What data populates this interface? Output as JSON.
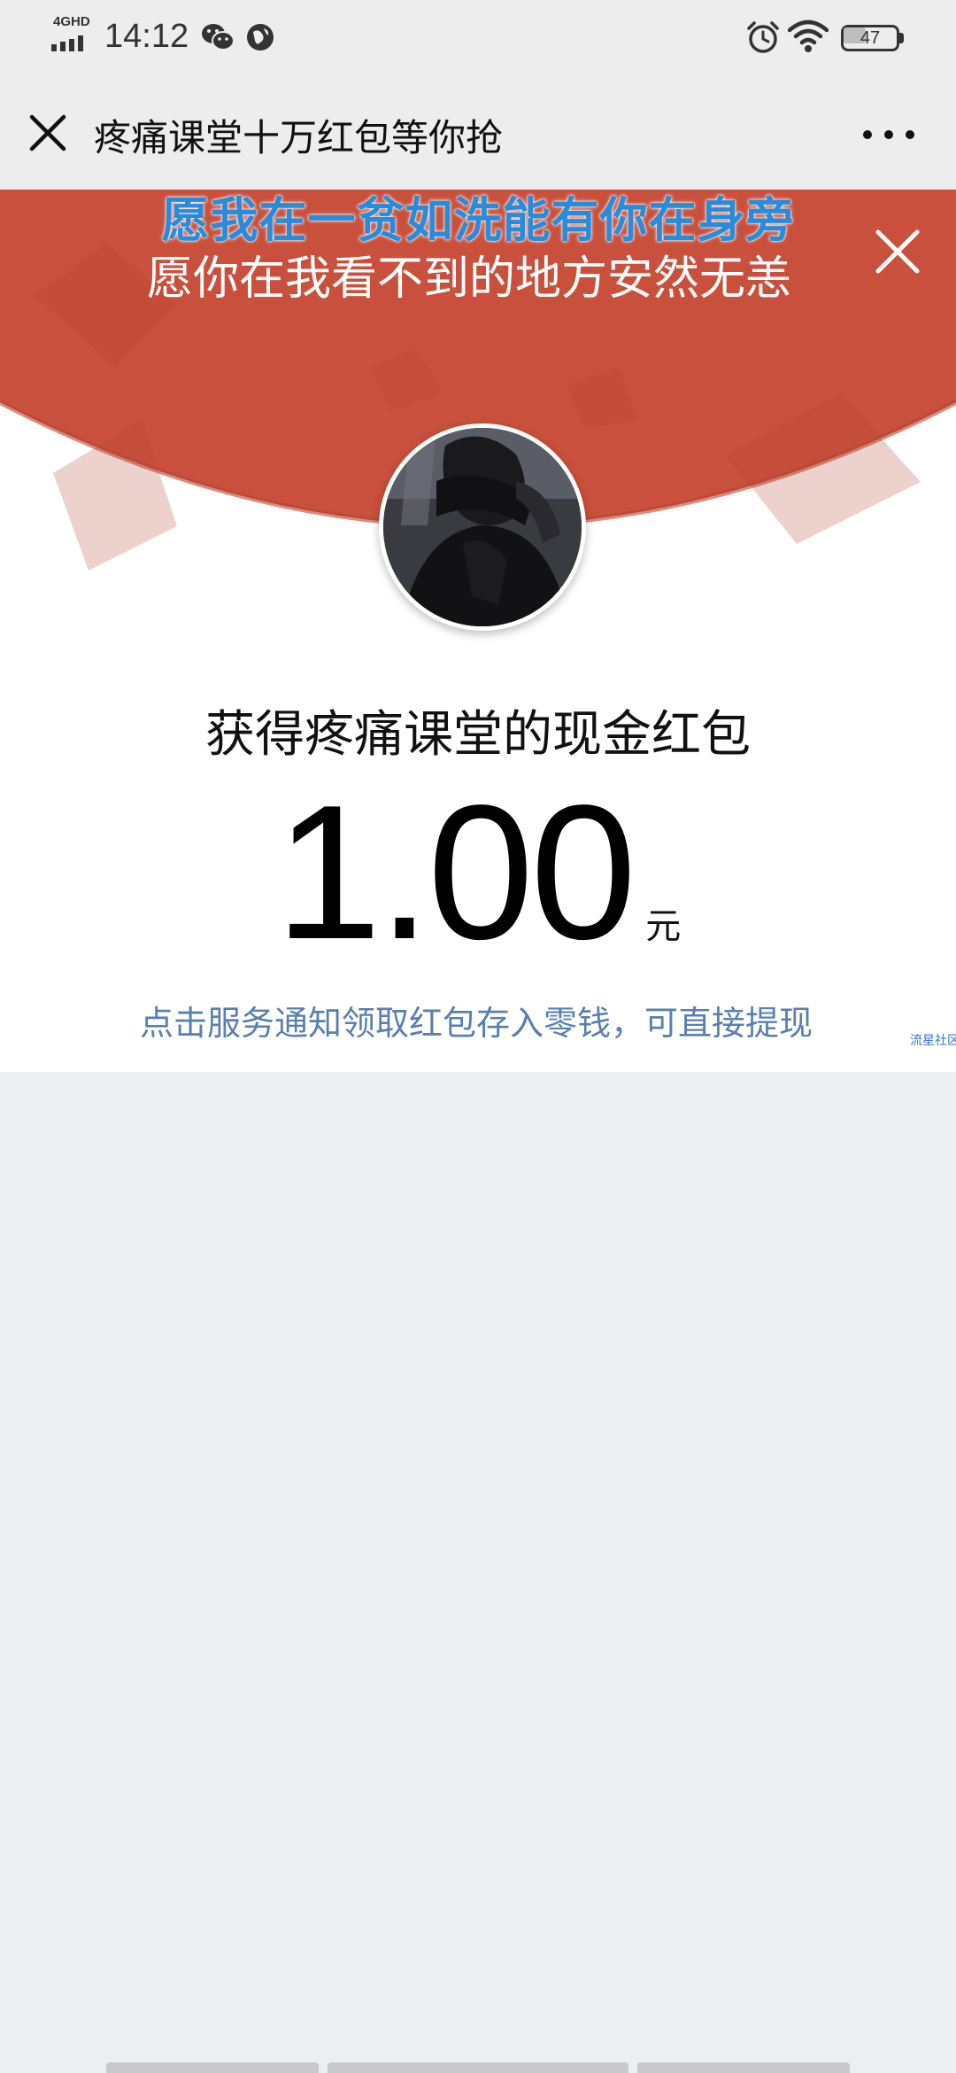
{
  "status_bar": {
    "network": "4GHD",
    "time": "14:12",
    "battery": "47",
    "battery_level": 0.47
  },
  "nav": {
    "title": "疼痛课堂十万红包等你抢"
  },
  "banner": {
    "line1": "愿我在一贫如洗能有你在身旁",
    "line2": "愿你在我看不到的地方安然无恙"
  },
  "packet": {
    "received_text": "获得疼痛课堂的现金红包",
    "amount": "1.00",
    "unit": "元",
    "claim_hint": "点击服务通知领取红包存入零钱，可直接提现",
    "watermark": "流星社区"
  },
  "colors": {
    "red": "#c9503c",
    "link": "#5a7fb0",
    "banner_blue": "#2a8bd8",
    "background": "#edeef2"
  }
}
